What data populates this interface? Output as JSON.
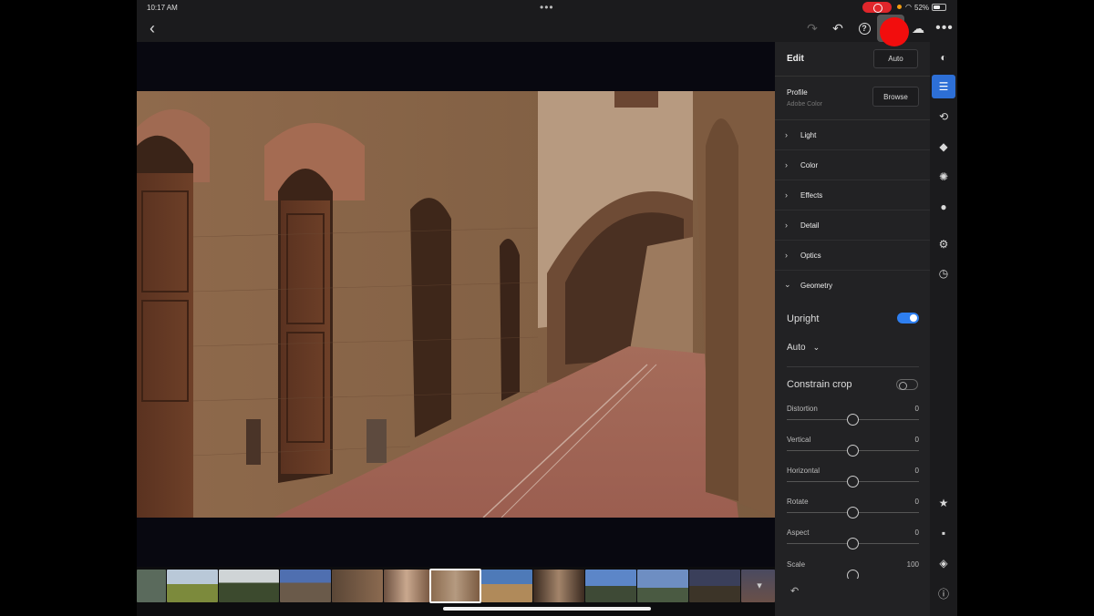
{
  "status_bar": {
    "time": "10:17 AM",
    "battery": "52%"
  },
  "toolbar": {
    "icons": [
      "back-icon",
      "redo-icon",
      "undo-icon",
      "help-icon",
      "share-icon",
      "cloud-sync-icon",
      "more-icon"
    ]
  },
  "panel": {
    "title": "Edit",
    "auto_label": "Auto",
    "profile": {
      "label": "Profile",
      "value": "Adobe Color",
      "browse_label": "Browse"
    },
    "sections": [
      {
        "label": "Light",
        "expanded": false
      },
      {
        "label": "Color",
        "expanded": false
      },
      {
        "label": "Effects",
        "expanded": false
      },
      {
        "label": "Detail",
        "expanded": false
      },
      {
        "label": "Optics",
        "expanded": false
      },
      {
        "label": "Geometry",
        "expanded": true
      }
    ],
    "geometry": {
      "upright_label": "Upright",
      "upright_enabled": true,
      "upright_mode": "Auto",
      "constrain_label": "Constrain crop",
      "constrain_enabled": false,
      "sliders": [
        {
          "label": "Distortion",
          "value": "0"
        },
        {
          "label": "Vertical",
          "value": "0"
        },
        {
          "label": "Horizontal",
          "value": "0"
        },
        {
          "label": "Rotate",
          "value": "0"
        },
        {
          "label": "Aspect",
          "value": "0"
        },
        {
          "label": "Scale",
          "value": "100"
        }
      ]
    }
  },
  "rail": {
    "icons": [
      "presets-icon",
      "edit-sliders-icon",
      "crop-icon",
      "healing-icon",
      "masking-icon",
      "blur-icon",
      "versions-icon",
      "history-icon",
      "rating-star-icon",
      "comment-icon",
      "tag-icon",
      "info-icon"
    ],
    "active": "edit-sliders-icon"
  },
  "filmstrip": {
    "selected_index": 6,
    "count": 13
  },
  "colors": {
    "accent": "#2e7ff0",
    "panel_bg": "#222224",
    "touch_indicator": "#f20d0d"
  }
}
